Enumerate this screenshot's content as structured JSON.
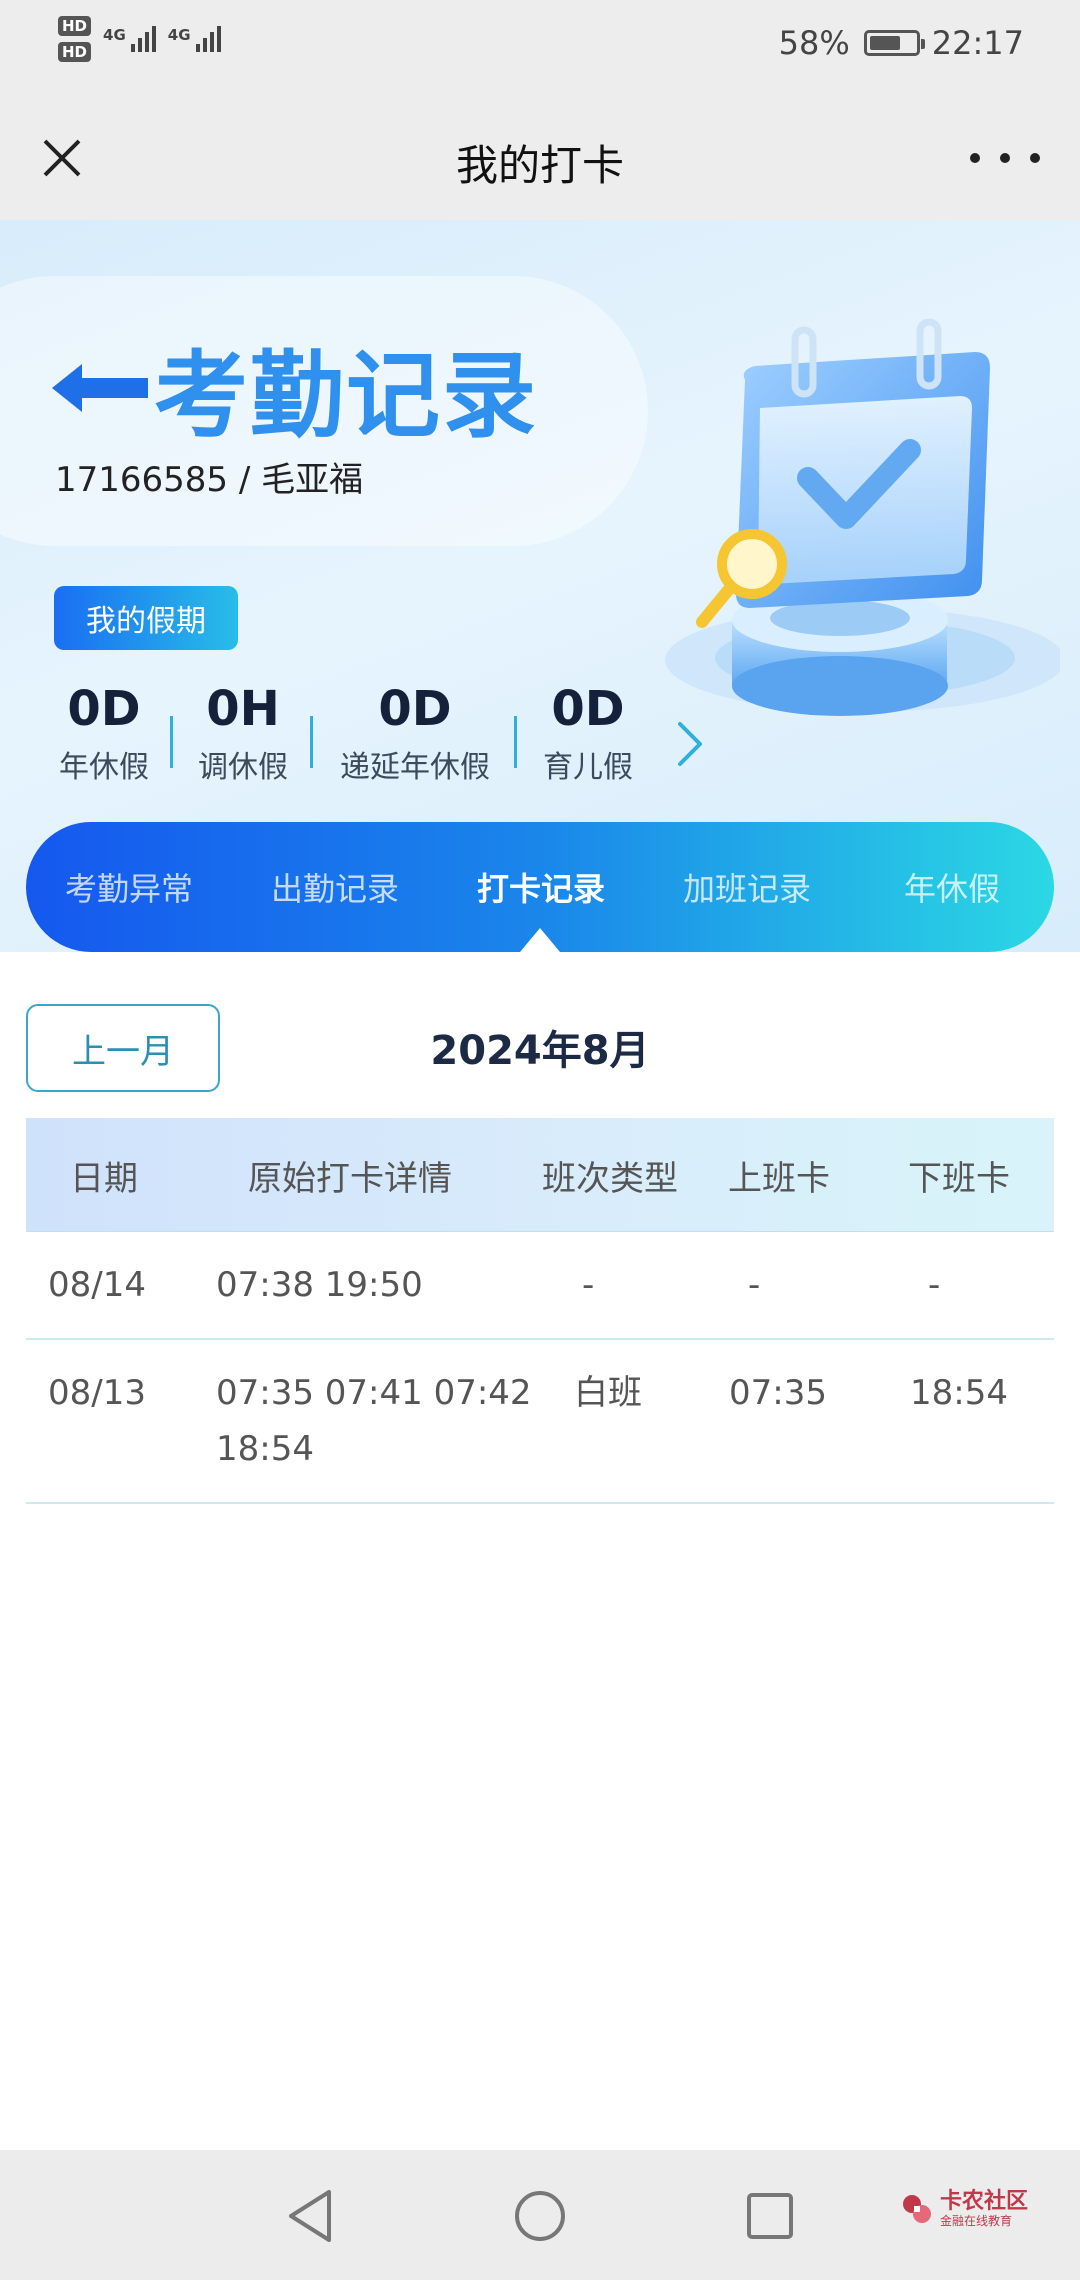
{
  "status_bar": {
    "sim1": "HD",
    "sim2": "HD",
    "net1": "4G",
    "net2": "4G",
    "battery": "58%",
    "time": "22:17"
  },
  "titlebar": {
    "title": "我的打卡"
  },
  "hero": {
    "title": "考勤记录",
    "user": "17166585 / 毛亚福",
    "vacation_badge": "我的假期",
    "vacation": [
      {
        "value": "0D",
        "label": "年休假"
      },
      {
        "value": "0H",
        "label": "调休假"
      },
      {
        "value": "0D",
        "label": "递延年休假"
      },
      {
        "value": "0D",
        "label": "育儿假"
      }
    ]
  },
  "tabs": [
    {
      "label": "考勤异常",
      "active": false
    },
    {
      "label": "出勤记录",
      "active": false
    },
    {
      "label": "打卡记录",
      "active": true
    },
    {
      "label": "加班记录",
      "active": false
    },
    {
      "label": "年休假",
      "active": false
    }
  ],
  "records": {
    "prev_month_label": "上一月",
    "month": "2024年8月",
    "columns": [
      "日期",
      "原始打卡详情",
      "班次类型",
      "上班卡",
      "下班卡"
    ],
    "rows": [
      {
        "date": "08/14",
        "detail_line1": "07:38 19:50",
        "detail_line2": "",
        "shift": "-",
        "in": "-",
        "out": "-"
      },
      {
        "date": "08/13",
        "detail_line1": "07:35 07:41 07:42",
        "detail_line2": "18:54",
        "shift": "白班",
        "in": "07:35",
        "out": "18:54"
      }
    ]
  },
  "watermark": {
    "main": "卡农社区",
    "sub": "金融在线教育"
  },
  "colors": {
    "accent": "#1a86ea",
    "title_blue": "#2f90ee",
    "tab_gradient_start": "#1558ef",
    "tab_gradient_end": "#2bd8e4",
    "table_header_bg": "#d9ecfb"
  }
}
